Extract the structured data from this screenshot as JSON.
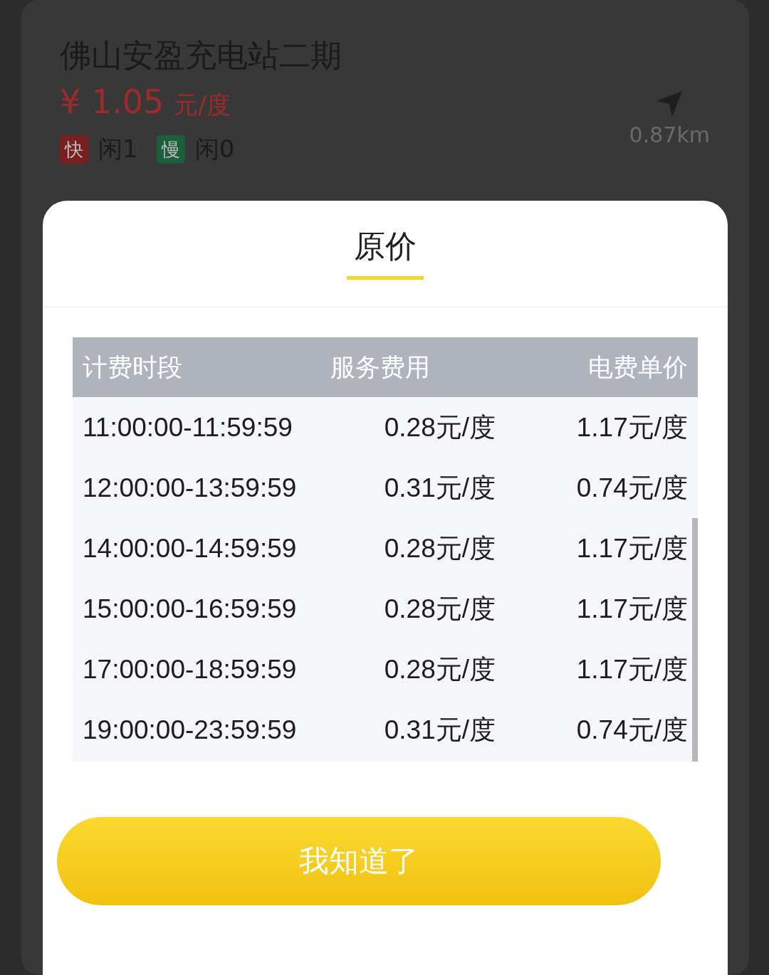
{
  "station": {
    "name": "佛山安盈充电站二期",
    "currency": "¥",
    "price": "1.05",
    "unit": "元/度",
    "distance": "0.87km",
    "chargers": [
      {
        "badge": "快",
        "color": "#7a1f1f",
        "idle": "闲1"
      },
      {
        "badge": "慢",
        "color": "#1d5e3c",
        "idle": "闲0"
      }
    ]
  },
  "dialog": {
    "tabs": [
      {
        "label": "原价",
        "selected": true
      }
    ],
    "table": {
      "columns": [
        "计费时段",
        "服务费用",
        "电费单价"
      ],
      "rows": [
        [
          "11:00:00-11:59:59",
          "0.28元/度",
          "1.17元/度"
        ],
        [
          "12:00:00-13:59:59",
          "0.31元/度",
          "0.74元/度"
        ],
        [
          "14:00:00-14:59:59",
          "0.28元/度",
          "1.17元/度"
        ],
        [
          "15:00:00-16:59:59",
          "0.28元/度",
          "1.17元/度"
        ],
        [
          "17:00:00-18:59:59",
          "0.28元/度",
          "1.17元/度"
        ],
        [
          "19:00:00-23:59:59",
          "0.31元/度",
          "0.74元/度"
        ]
      ]
    },
    "button": "我知道了"
  }
}
